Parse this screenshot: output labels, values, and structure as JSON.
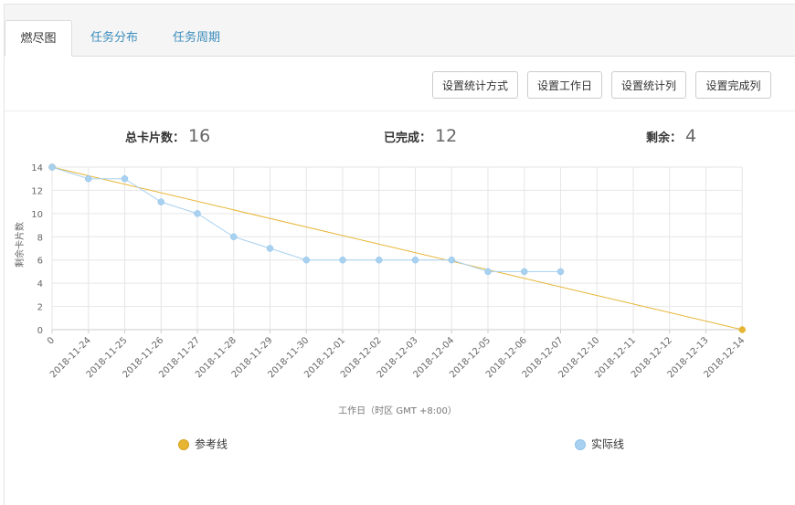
{
  "tabs": [
    {
      "label": "燃尽图",
      "active": true
    },
    {
      "label": "任务分布",
      "active": false
    },
    {
      "label": "任务周期",
      "active": false
    }
  ],
  "toolbar": {
    "buttons": [
      "设置统计方式",
      "设置工作日",
      "设置统计列",
      "设置完成列"
    ]
  },
  "stats": {
    "total_label": "总卡片数",
    "total_value": "16",
    "done_label": "已完成",
    "done_value": "12",
    "remaining_label": "剩余",
    "remaining_value": "4",
    "colon": "："
  },
  "colors": {
    "reference": "#e6b533",
    "actual": "#a8d1f0",
    "link": "#3c8dbc"
  },
  "chart_data": {
    "type": "line",
    "xlabel": "工作日（时区 GMT +8:00）",
    "ylabel": "剩余卡片数",
    "categories": [
      "0",
      "2018-11-24",
      "2018-11-25",
      "2018-11-26",
      "2018-11-27",
      "2018-11-28",
      "2018-11-29",
      "2018-11-30",
      "2018-12-01",
      "2018-12-02",
      "2018-12-03",
      "2018-12-04",
      "2018-12-05",
      "2018-12-06",
      "2018-12-07",
      "2018-12-10",
      "2018-12-11",
      "2018-12-12",
      "2018-12-13",
      "2018-12-14"
    ],
    "yticks": [
      0,
      2,
      4,
      6,
      8,
      10,
      12,
      14
    ],
    "ylim": [
      0,
      14
    ],
    "grid": true,
    "legend_position": "bottom",
    "series": [
      {
        "name": "参考线",
        "values": [
          14,
          null,
          null,
          null,
          null,
          null,
          null,
          null,
          null,
          null,
          null,
          null,
          null,
          null,
          null,
          null,
          null,
          null,
          null,
          0
        ]
      },
      {
        "name": "实际线",
        "values": [
          14,
          13,
          13,
          11,
          10,
          8,
          7,
          6,
          6,
          6,
          6,
          6,
          5,
          5,
          5
        ]
      }
    ]
  }
}
